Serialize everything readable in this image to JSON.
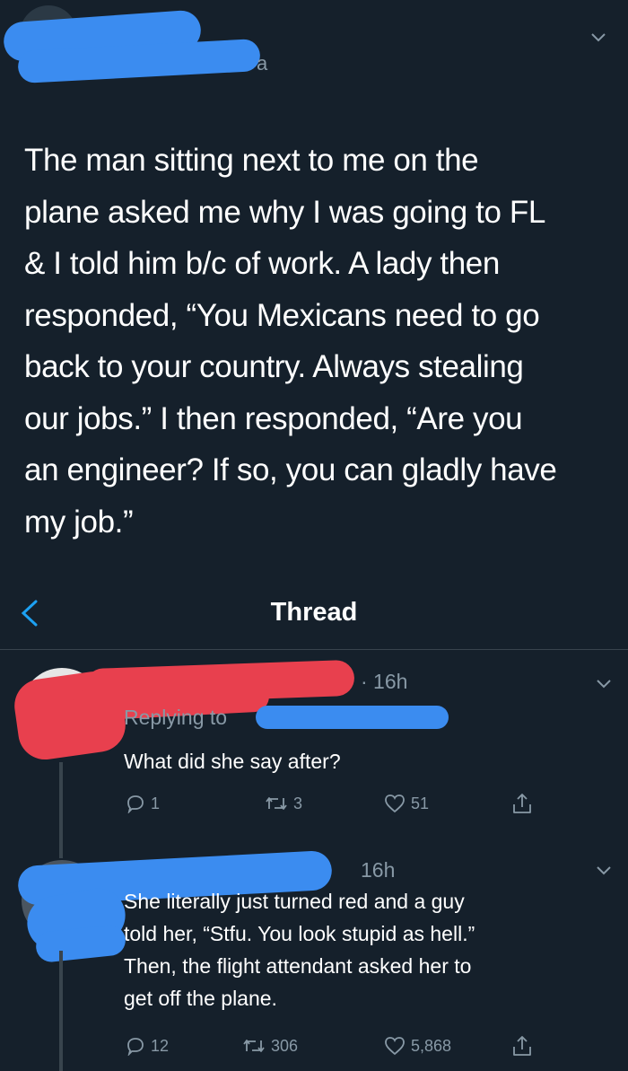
{
  "top_tweet": {
    "text": "The man sitting next to me on the\nplane asked me why I was going to FL\n& I told him b/c of work. A lady then\nresponded, “You Mexicans need to go\nback to your country. Always stealing\nour jobs.” I then responded, “Are you\nan engineer? If so, you can gladly have\nmy job.”",
    "handle_fragment": "a"
  },
  "header": {
    "title": "Thread"
  },
  "replies": [
    {
      "time": "· 16h",
      "replying_to_label": "Replying to",
      "text": "What did she say after?",
      "reply_count": "1",
      "retweet_count": "3",
      "like_count": "51"
    },
    {
      "time": "16h",
      "text": "She literally just turned red and a guy\ntold her, “Stfu. You look stupid as hell.”\nThen, the flight attendant asked her to\nget off the plane.",
      "reply_count": "12",
      "retweet_count": "306",
      "like_count": "5,868"
    }
  ],
  "colors": {
    "background": "#15202b",
    "accent": "#1da1f2",
    "muted": "#8899a6",
    "redact_blue": "#3b8cf0",
    "redact_red": "#e8404e"
  },
  "icons": [
    "chevron-down-icon",
    "back-arrow-icon",
    "reply-icon",
    "retweet-icon",
    "like-icon",
    "share-icon"
  ]
}
